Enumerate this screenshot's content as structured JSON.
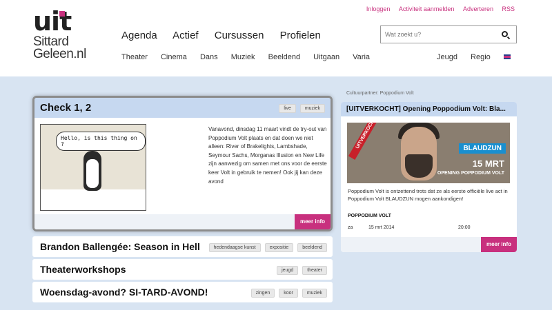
{
  "header": {
    "logo": {
      "word": "uit",
      "city_line1": "Sittard",
      "city_line2": "Geleen.nl"
    },
    "toplinks": [
      "Inloggen",
      "Activiteit aanmelden",
      "Adverteren",
      "RSS"
    ],
    "mainnav": [
      "Agenda",
      "Actief",
      "Cursussen",
      "Profielen"
    ],
    "subnav": [
      "Theater",
      "Cinema",
      "Dans",
      "Muziek",
      "Beeldend",
      "Uitgaan",
      "Varia"
    ],
    "rightnav": [
      "Jeugd",
      "Regio"
    ],
    "search_placeholder": "Wat zoekt u?"
  },
  "feature": {
    "title": "Check 1, 2",
    "tags": [
      "live",
      "muziek"
    ],
    "image_caption": "Hello, is this thing on ?",
    "text": "Vanavond, dinsdag 11 maart vindt de try-out van Poppodium Volt plaats en dat doen we niet alleen: River of Brakelights, Lambshade, Seymour Sachs, Morganas Illusion en New Life zijn aanwezig om samen met ons voor de eerste keer Volt in gebruik te nemen! Ook jij kan deze avond",
    "more": "meer info"
  },
  "rows": [
    {
      "title": "Brandon Ballengée: Season in Hell",
      "tags": [
        "hedendaagse kunst",
        "expositie",
        "beeldend"
      ]
    },
    {
      "title": "Theaterworkshops",
      "tags": [
        "jeugd",
        "theater"
      ]
    },
    {
      "title": "Woensdag-avond? SI-TARD-AVOND!",
      "tags": [
        "zingen",
        "koor",
        "muziek"
      ]
    }
  ],
  "side": {
    "label": "Cultuurpartner: Poppodium Volt",
    "title": "[UITVERKOCHT] Opening Poppodium Volt: Bla...",
    "banner": {
      "sticker": "UITVERKOCHT",
      "band": "BLAUDZUN",
      "date": "15 MRT",
      "sub": "OPENING POPPODIUM VOLT"
    },
    "text": "Poppodium Volt is ontzettend trots dat ze als eerste officiële live act in Poppodium Volt BLAUDZUN mogen aankondigen!",
    "venue": "POPPODIUM VOLT",
    "day": "za",
    "date": "15 mrt 2014",
    "time": "20:00",
    "more": "meer info"
  },
  "colors": {
    "accent": "#c8307e",
    "page_bg": "#d8e4f2",
    "card_head": "#c6d8f0"
  }
}
